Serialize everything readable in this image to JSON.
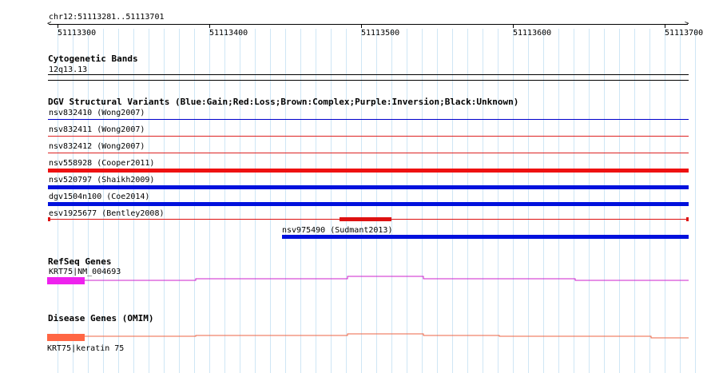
{
  "ruler": {
    "chrom_label": "chr12:51113281..51113701",
    "ticks": [
      "51113300",
      "51113400",
      "51113500",
      "51113600",
      "51113700"
    ]
  },
  "tracks": {
    "cytogenetic_bands": {
      "title": "Cytogenetic Bands",
      "band_label": "12q13.13"
    },
    "dgv": {
      "title": "DGV Structural Variants (Blue:Gain;Red:Loss;Brown:Complex;Purple:Inversion;Black:Unknown)",
      "variants": [
        {
          "label": "nsv832410 (Wong2007)",
          "type": "gain",
          "color": "#0000cc"
        },
        {
          "label": "nsv832411 (Wong2007)",
          "type": "loss",
          "color": "#dd2222"
        },
        {
          "label": "nsv832412 (Wong2007)",
          "type": "loss",
          "color": "#dd2222"
        },
        {
          "label": "nsv558928 (Cooper2011)",
          "type": "loss",
          "color": "#ee1111"
        },
        {
          "label": "nsv520797 (Shaikh2009)",
          "type": "gain",
          "color": "#0011dd"
        },
        {
          "label": "dgv1504n100 (Coe2014)",
          "type": "gain",
          "color": "#0011dd"
        },
        {
          "label": "esv1925677 (Bentley2008)",
          "type": "loss",
          "color": "#dd1111"
        },
        {
          "label": "nsv975490 (Sudmant2013)",
          "type": "gain",
          "color": "#0011dd"
        }
      ]
    },
    "refseq": {
      "title": "RefSeq Genes",
      "gene_label": "KRT75|NM_004693",
      "color": "#cc22cc"
    },
    "omim": {
      "title": "Disease Genes (OMIM)",
      "gene_label": "KRT75|keratin 75",
      "color": "#ee6644"
    }
  }
}
